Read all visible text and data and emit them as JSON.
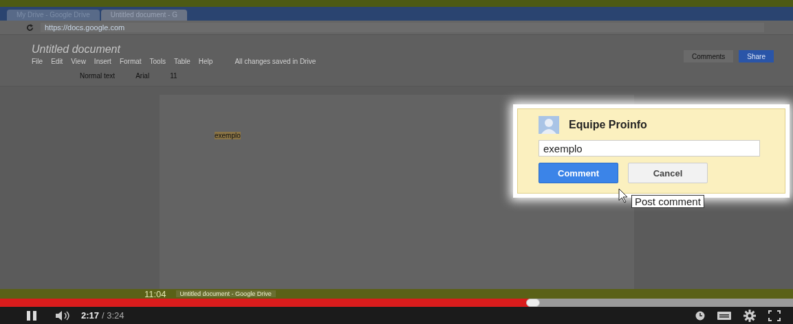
{
  "browser": {
    "tabs": [
      {
        "title": "My Drive - Google Drive",
        "selected": false
      },
      {
        "title": "Untitled document - G",
        "selected": true
      }
    ],
    "url": "https://docs.google.com"
  },
  "document": {
    "title": "Untitled document",
    "menu": [
      "File",
      "Edit",
      "View",
      "Insert",
      "Format",
      "Tools",
      "Table",
      "Help"
    ],
    "save_status": "All changes saved in Drive",
    "style": "Normal text",
    "font": "Arial",
    "size": "11",
    "buttons": [
      "Comments",
      "Share"
    ],
    "body_text": "exemplo"
  },
  "comment_popup": {
    "author": "Equipe Proinfo",
    "value": "exemplo",
    "buttons": [
      "Comment",
      "Cancel"
    ],
    "tooltip": "Post comment"
  },
  "taskbar": {
    "clock": "11:04",
    "window": "Untitled document - Google Drive"
  },
  "player": {
    "playing": true,
    "level": 0.672,
    "current_time": "2:17",
    "duration": "/ 3:24"
  }
}
